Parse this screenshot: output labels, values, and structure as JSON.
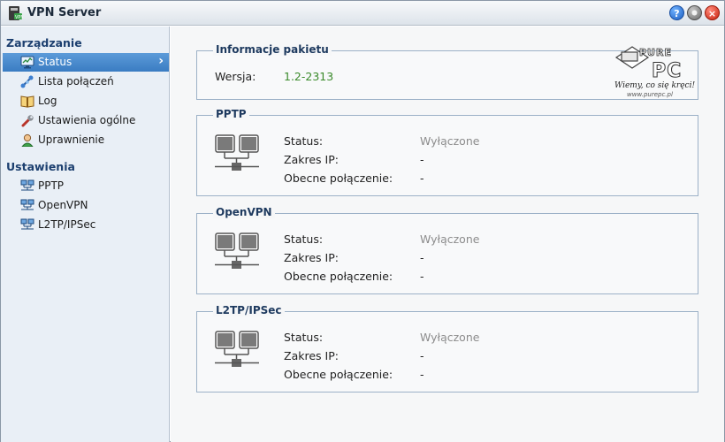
{
  "window": {
    "title": "VPN Server"
  },
  "titlebar": {
    "help_symbol": "?",
    "close_symbol": "×"
  },
  "sidebar": {
    "groups": [
      {
        "title": "Zarządzanie",
        "items": [
          {
            "label": "Status",
            "icon": "monitor-icon",
            "active": true
          },
          {
            "label": "Lista połączeń",
            "icon": "connections-icon"
          },
          {
            "label": "Log",
            "icon": "book-icon"
          },
          {
            "label": "Ustawienia ogólne",
            "icon": "wrench-icon"
          },
          {
            "label": "Uprawnienie",
            "icon": "user-icon"
          }
        ]
      },
      {
        "title": "Ustawienia",
        "items": [
          {
            "label": "PPTP",
            "icon": "network-icon"
          },
          {
            "label": "OpenVPN",
            "icon": "network-icon"
          },
          {
            "label": "L2TP/IPSec",
            "icon": "network-icon"
          }
        ]
      }
    ]
  },
  "package_info": {
    "title": "Informacje pakietu",
    "version_label": "Wersja:",
    "version_value": "1.2-2313"
  },
  "services": [
    {
      "title": "PPTP",
      "status_label": "Status:",
      "status_value": "Wyłączone",
      "ip_label": "Zakres IP:",
      "ip_value": "-",
      "conn_label": "Obecne połączenie:",
      "conn_value": "-"
    },
    {
      "title": "OpenVPN",
      "status_label": "Status:",
      "status_value": "Wyłączone",
      "ip_label": "Zakres IP:",
      "ip_value": "-",
      "conn_label": "Obecne połączenie:",
      "conn_value": "-"
    },
    {
      "title": "L2TP/IPSec",
      "status_label": "Status:",
      "status_value": "Wyłączone",
      "ip_label": "Zakres IP:",
      "ip_value": "-",
      "conn_label": "Obecne połączenie:",
      "conn_value": "-"
    }
  ],
  "watermark": {
    "brand": "PUREPC",
    "tagline": "Wiemy, co się kręci!",
    "url": "www.purepc.pl"
  },
  "colors": {
    "accent": "#3a7cc2",
    "version_green": "#3a8a2a",
    "status_gray": "#8c8c8c",
    "panel_border": "#9cb1c7"
  }
}
